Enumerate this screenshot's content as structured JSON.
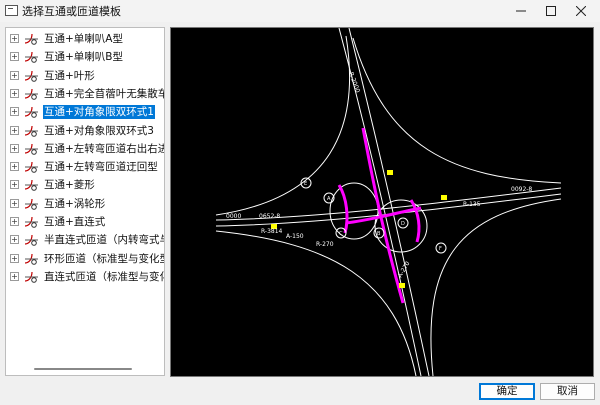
{
  "window": {
    "title": "选择互通或匝道模板"
  },
  "tree": {
    "items": [
      {
        "label": "互通+单喇叭A型",
        "selected": false
      },
      {
        "label": "互通+单喇叭B型",
        "selected": false
      },
      {
        "label": "互通+叶形",
        "selected": false
      },
      {
        "label": "互通+完全苜蓿叶无集散车道",
        "selected": false
      },
      {
        "label": "互通+对角象限双环式1",
        "selected": true
      },
      {
        "label": "互通+对角象限双环式3",
        "selected": false
      },
      {
        "label": "互通+左转弯匝道右出右进式",
        "selected": false
      },
      {
        "label": "互通+左转弯匝道迂回型",
        "selected": false
      },
      {
        "label": "互通+菱形",
        "selected": false
      },
      {
        "label": "互通+涡轮形",
        "selected": false
      },
      {
        "label": "互通+直连式",
        "selected": false
      },
      {
        "label": "半直连式匝道（内转弯式与外转弯式）",
        "selected": false
      },
      {
        "label": "环形匝道（标准型与变化型）",
        "selected": false
      },
      {
        "label": "直连式匝道（标准型与变化型）",
        "selected": false
      }
    ]
  },
  "buttons": {
    "ok": "确定",
    "cancel": "取消"
  },
  "preview": {
    "labels": {
      "r_top": "R-2000",
      "r_left": "R-3814",
      "a_150": "A-150",
      "r_270": "R-270",
      "a_270": "A-270",
      "r_135": "R-135",
      "c_0": "0000",
      "c_1": "0652-8",
      "c_2": "0092-8",
      "circle_a": "A",
      "circle_b": "B",
      "circle_c": "C",
      "circle_d": "D",
      "circle_e": "E",
      "circle_f": "F"
    },
    "colors": {
      "road": "#ffffff",
      "highlight": "#ff00ff",
      "marker": "#ffff00"
    }
  }
}
